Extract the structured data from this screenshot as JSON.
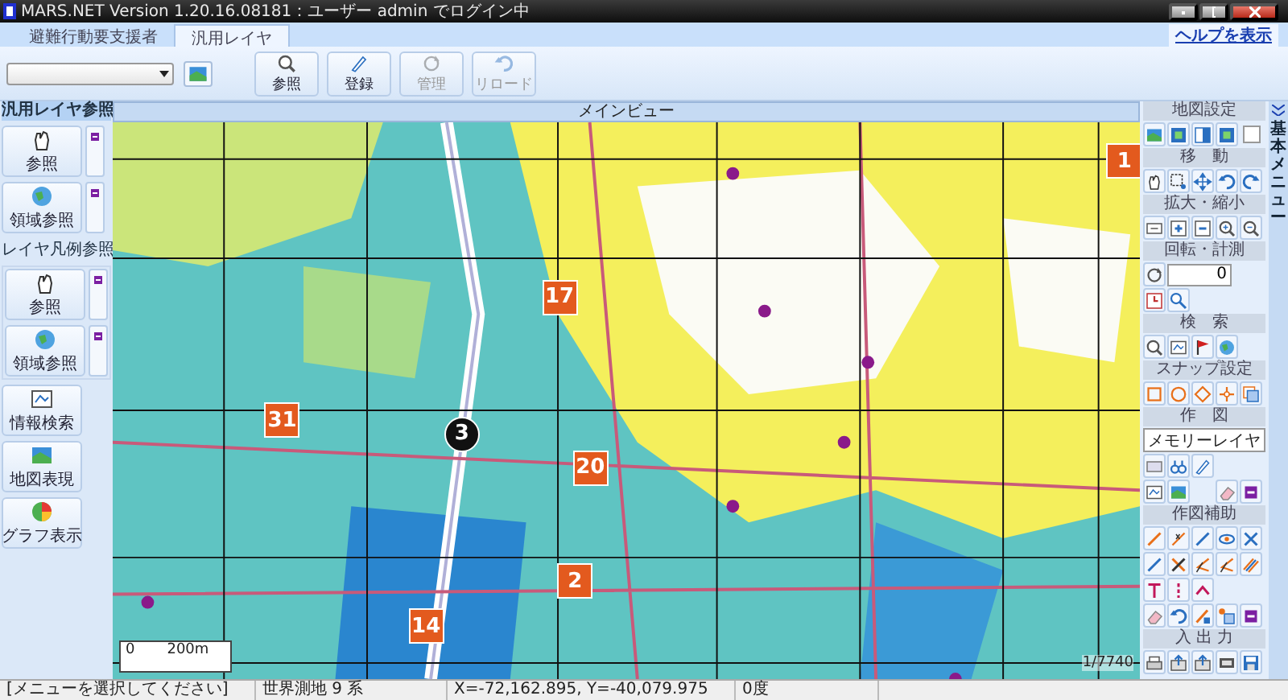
{
  "window": {
    "title": "MARS.NET Version 1.20.16.08181：ユーザー admin でログイン中"
  },
  "tabs": [
    {
      "label": "避難行動要支援者",
      "selected": false
    },
    {
      "label": "汎用レイヤ",
      "selected": true
    }
  ],
  "help_link": "ヘルプを表示",
  "toolbar": {
    "buttons": [
      {
        "label": "参照",
        "disabled": false
      },
      {
        "label": "登録",
        "disabled": false
      },
      {
        "label": "管理",
        "disabled": true
      },
      {
        "label": "リロード",
        "disabled": true
      }
    ]
  },
  "left_panel": {
    "sections": [
      {
        "title": "汎用レイヤ参照",
        "buttons": [
          {
            "label": "参照"
          },
          {
            "label": "領域参照"
          }
        ]
      },
      {
        "title": "レイヤ凡例参照",
        "buttons": [
          {
            "label": "参照"
          },
          {
            "label": "領域参照"
          }
        ]
      }
    ],
    "tools": [
      {
        "label": "情報検索"
      },
      {
        "label": "地図表現"
      },
      {
        "label": "グラフ表示"
      }
    ]
  },
  "main_view": {
    "title": "メインビュー",
    "markers": [
      {
        "label": "1",
        "kind": "square"
      },
      {
        "label": "17",
        "kind": "square"
      },
      {
        "label": "31",
        "kind": "square"
      },
      {
        "label": "3",
        "kind": "circle"
      },
      {
        "label": "20",
        "kind": "square"
      },
      {
        "label": "2",
        "kind": "square"
      },
      {
        "label": "14",
        "kind": "square"
      }
    ],
    "scale": {
      "zero": "0",
      "distance": "200m"
    },
    "ratio": "1/7740"
  },
  "right_panel": {
    "sections": [
      {
        "title": "地図設定",
        "checkbox": {
          "checked": false
        }
      },
      {
        "title": "移　動"
      },
      {
        "title": "拡大・縮小"
      },
      {
        "title": "回転・計測",
        "angle": "0"
      },
      {
        "title": "検　索"
      },
      {
        "title": "スナップ設定"
      },
      {
        "title": "作　図",
        "layer": "メモリーレイヤ"
      },
      {
        "title": "作図補助"
      },
      {
        "title": "入 出 力"
      }
    ]
  },
  "side_tab": {
    "label": "基本メニュー"
  },
  "status_bar": [
    "[メニューを選択してください]",
    "世界測地 9 系",
    "X=-72,162.895,  Y=-40,079.975",
    "0度"
  ]
}
